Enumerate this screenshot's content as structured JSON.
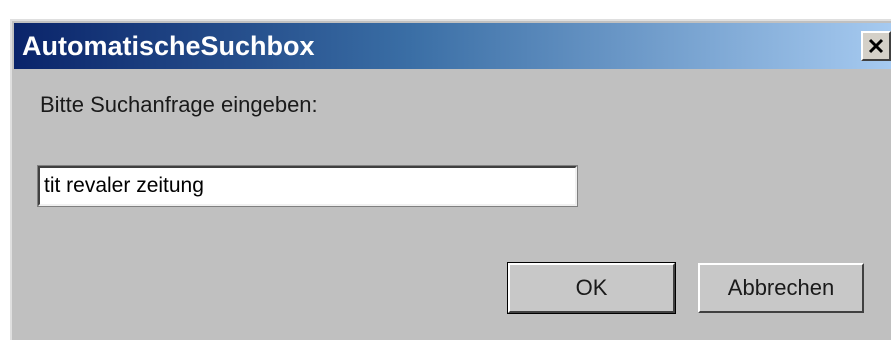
{
  "dialog": {
    "title": "AutomatischeSuchbox",
    "close_icon": "close-icon",
    "prompt": "Bitte Suchanfrage eingeben:",
    "query_value": "tit revaler zeitung",
    "ok_label": "OK",
    "cancel_label": "Abbrechen"
  },
  "colors": {
    "titlebar_start": "#0a246a",
    "titlebar_end": "#a6caf0",
    "window_bg": "#c0c0c0"
  }
}
